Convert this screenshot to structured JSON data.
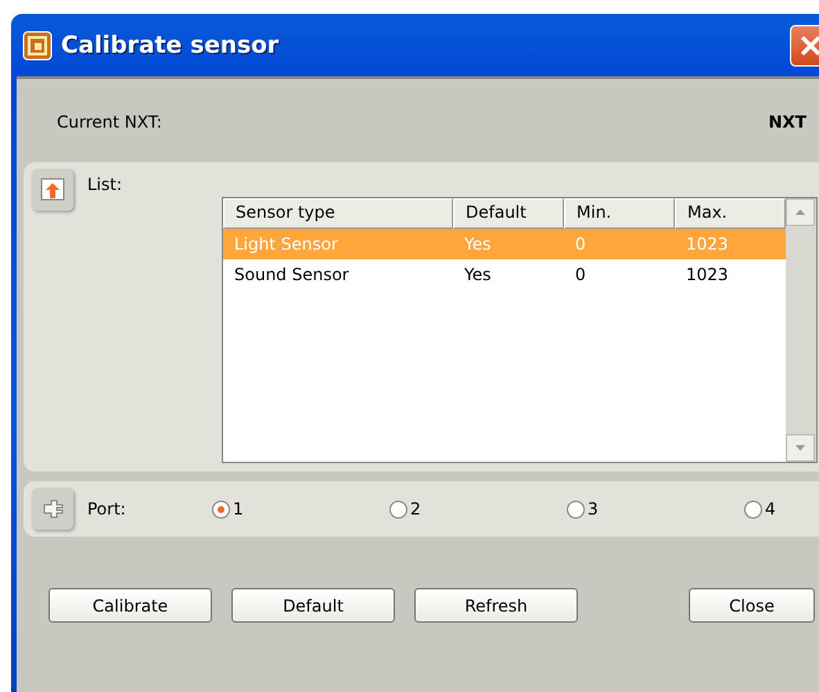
{
  "window": {
    "title": "Calibrate sensor"
  },
  "current_nxt": {
    "label": "Current NXT:",
    "value": "NXT"
  },
  "list": {
    "label": "List:",
    "columns": [
      "Sensor type",
      "Default",
      "Min.",
      "Max."
    ],
    "rows": [
      {
        "cells": [
          "Light Sensor",
          "Yes",
          "0",
          "1023"
        ],
        "selected": true
      },
      {
        "cells": [
          "Sound Sensor",
          "Yes",
          "0",
          "1023"
        ],
        "selected": false
      }
    ]
  },
  "port": {
    "label": "Port:",
    "options": [
      {
        "label": "1",
        "selected": true
      },
      {
        "label": "2",
        "selected": false
      },
      {
        "label": "3",
        "selected": false
      },
      {
        "label": "4",
        "selected": false
      }
    ]
  },
  "buttons": [
    {
      "label": "Calibrate",
      "kind": "left"
    },
    {
      "label": "Default",
      "kind": "left"
    },
    {
      "label": "Refresh",
      "kind": "left"
    },
    {
      "label": "Close",
      "kind": "right"
    }
  ]
}
